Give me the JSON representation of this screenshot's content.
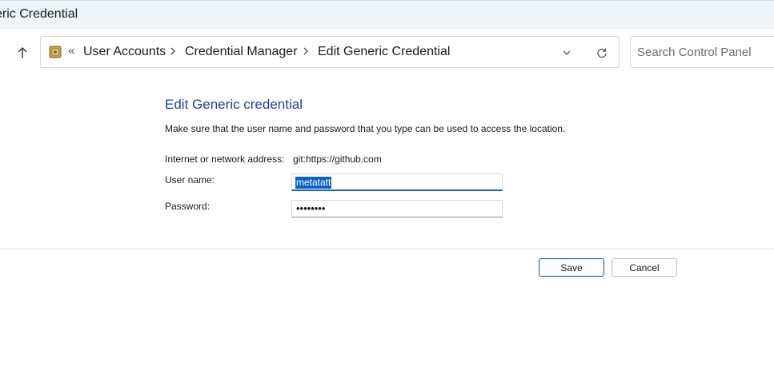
{
  "window": {
    "title": "eric Credential"
  },
  "nav": {
    "up_icon": "up-arrow-icon",
    "breadcrumb_overflow": "«",
    "breadcrumbs": [
      {
        "label": "User Accounts"
      },
      {
        "label": "Credential Manager"
      },
      {
        "label": "Edit Generic Credential"
      }
    ],
    "dropdown_icon": "chevron-down-icon",
    "refresh_icon": "refresh-icon",
    "search": {
      "placeholder": "Search Control Panel",
      "value": ""
    }
  },
  "form": {
    "heading": "Edit Generic credential",
    "instruction": "Make sure that the user name and password that you type can be used to access the location.",
    "address_label": "Internet or network address:",
    "address_value": "git:https://github.com",
    "username_label": "User name:",
    "username_value": "metatatt",
    "password_label": "Password:",
    "password_value": "••••••••"
  },
  "actions": {
    "save_label": "Save",
    "cancel_label": "Cancel"
  },
  "colors": {
    "heading": "#1f3f9c",
    "selection": "#0a64c8",
    "titlebar_bg": "#eef4f9"
  }
}
